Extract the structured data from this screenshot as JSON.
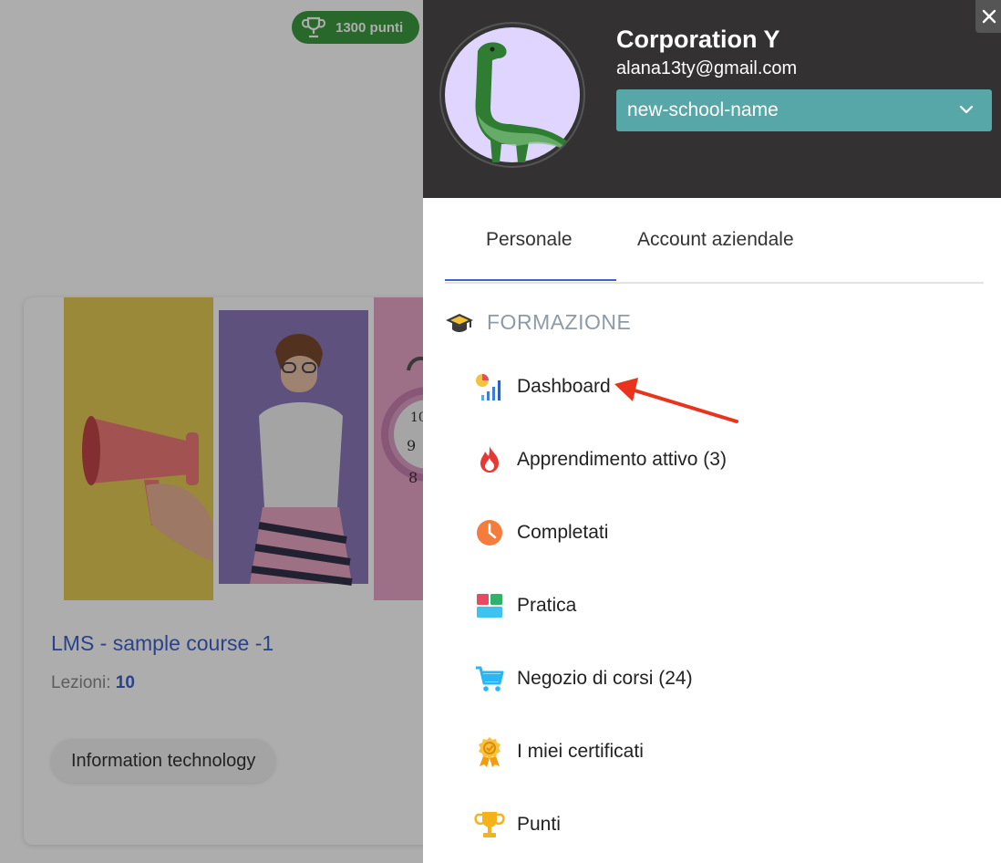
{
  "points_badge": {
    "label": "1300 punti",
    "icon": "trophy-icon"
  },
  "course": {
    "title": "LMS - sample course -1",
    "lessons_label": "Lezioni:",
    "lessons_count": "10",
    "category": "Information technology"
  },
  "profile": {
    "name": "Corporation Y",
    "email": "alana13ty@gmail.com",
    "school_selected": "new-school-name"
  },
  "tabs": [
    {
      "label": "Personale",
      "active": true
    },
    {
      "label": "Account aziendale",
      "active": false
    }
  ],
  "section": {
    "title": "FORMAZIONE",
    "icon": "graduation-cap-icon"
  },
  "menu": [
    {
      "label": "Dashboard",
      "icon": "dashboard-chart-icon"
    },
    {
      "label": "Apprendimento attivo (3)",
      "icon": "flame-icon"
    },
    {
      "label": "Completati",
      "icon": "clock-icon"
    },
    {
      "label": "Pratica",
      "icon": "grid-blocks-icon"
    },
    {
      "label": "Negozio di corsi (24)",
      "icon": "cart-icon"
    },
    {
      "label": "I miei certificati",
      "icon": "certificate-badge-icon"
    },
    {
      "label": "Punti",
      "icon": "trophy-icon"
    }
  ],
  "colors": {
    "header_bg": "#333132",
    "select_bg": "#57a7a8",
    "accent_blue": "#3f63c9",
    "badge_green": "#3c9a3f",
    "annotation_arrow": "#e8341c"
  }
}
